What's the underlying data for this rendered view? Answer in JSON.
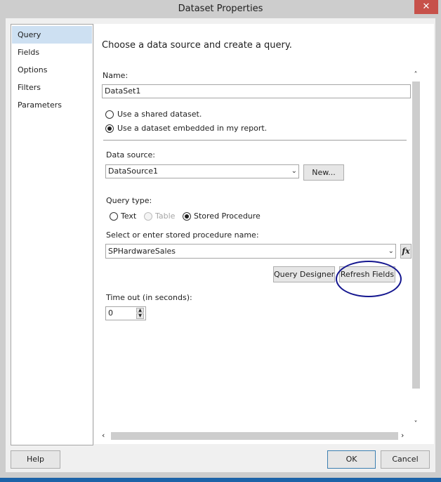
{
  "window": {
    "title": "Dataset Properties",
    "close_glyph": "✕"
  },
  "nav": {
    "items": [
      {
        "label": "Query",
        "selected": true
      },
      {
        "label": "Fields"
      },
      {
        "label": "Options"
      },
      {
        "label": "Filters"
      },
      {
        "label": "Parameters"
      }
    ]
  },
  "main": {
    "heading": "Choose a data source and create a query.",
    "name_label": "Name:",
    "name_value": "DataSet1",
    "radio_shared": "Use a shared dataset.",
    "radio_embedded": "Use a dataset embedded in my report.",
    "datasource_label": "Data source:",
    "datasource_value": "DataSource1",
    "new_button": "New...",
    "querytype_label": "Query type:",
    "querytype_options": [
      "Text",
      "Table",
      "Stored Procedure"
    ],
    "querytype_selected": "Stored Procedure",
    "sp_label": "Select or enter stored procedure name:",
    "sp_value": "SPHardwareSales",
    "fx_glyph": "fx",
    "query_designer_button": "Query Designer...",
    "refresh_fields_button": "Refresh Fields",
    "timeout_label": "Time out (in seconds):",
    "timeout_value": "0"
  },
  "footer": {
    "help": "Help",
    "ok": "OK",
    "cancel": "Cancel"
  },
  "colors": {
    "annotation_circle": "#14168f",
    "selected_nav": "#cde0f2",
    "close": "#c7514a"
  }
}
